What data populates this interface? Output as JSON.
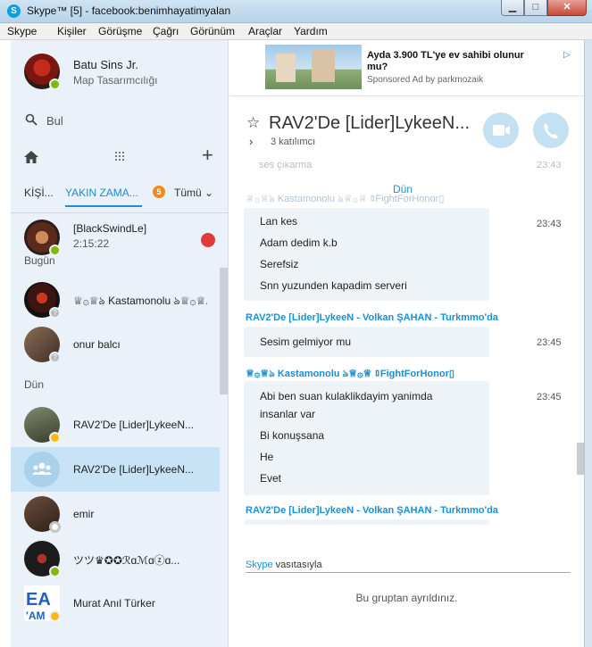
{
  "window": {
    "title": "Skype™ [5] - facebook:benimhayatimyalan",
    "app_icon": "S"
  },
  "menu": [
    "Skype",
    "Kişiler",
    "Görüşme",
    "Çağrı",
    "Görünüm",
    "Araçlar",
    "Yardım"
  ],
  "profile": {
    "name": "Batu Sins Jr.",
    "mood": "Map Tasarımcılığı",
    "status": "online"
  },
  "search": {
    "placeholder": "Bul"
  },
  "filters": {
    "contacts": "KİŞİ...",
    "recent": "YAKIN ZAMA...",
    "recent_count": "5",
    "all": "Tümü"
  },
  "contacts": [
    {
      "name": "[BlackSwindLe]",
      "sub": "2:15:22",
      "status": "online",
      "active_call": true
    },
    {
      "group_header": "Bugün"
    },
    {
      "name": "♕۞♕ঌ Kastamonolu ঌ♕۞♕...",
      "status": "unknown"
    },
    {
      "name": "onur balcı",
      "status": "unknown"
    },
    {
      "group_header": "Dün"
    },
    {
      "name": "RAV2'De [Lider]LykeeN...",
      "status": "away"
    },
    {
      "name": "RAV2'De [Lider]LykeeN...",
      "status": "group",
      "selected": true
    },
    {
      "name": "emir",
      "status": "offline"
    },
    {
      "name": "ツツ♛✪✪ℛɑℳɑⓩɑ...",
      "status": "online"
    },
    {
      "name": "Murat Anıl Türker",
      "status": "away"
    }
  ],
  "ad": {
    "title": "Ayda 3.900 TL'ye ev sahibi olunur mu?",
    "sponsor": "Sponsored Ad by parkmozaik",
    "adchoice": "▷"
  },
  "conversation": {
    "title": "RAV2'De [Lider]LykeeN...",
    "participants": "3 katılımcı",
    "messages_clipped_text": "ses çıkarma",
    "clipped_time": "23:43",
    "faded_sender": "♕۞♕ঌ Kastamonolu ঌ♕۞♕ ▯FightForHonor▯",
    "date_separator": "Dün",
    "groups": [
      {
        "lines": [
          "Lan kes",
          "Adam dedim k.b",
          "Serefsiz",
          "Snn yuzunden kapadim serveri"
        ],
        "time": "23:43"
      },
      {
        "sender": "RAV2'De [Lider]LykeeN - Volkan ŞAHAN - Turkmmo'da",
        "lines": [
          "Sesim gelmiyor mu"
        ],
        "time": "23:45"
      },
      {
        "sender": "♕۞♕ঌ Kastamonolu ঌ♕۞♕ ▯FightForHonor▯",
        "lines": [
          "Abi ben suan kulaklikdayim yanimda",
          "insanlar var",
          "Bi konuşsana",
          "He",
          "Evet"
        ],
        "time": "23:45"
      },
      {
        "sender": "RAV2'De [Lider]LykeeN - Volkan ŞAHAN - Turkmmo'da",
        "lines": []
      }
    ],
    "via_brand": "Skype",
    "via_text": " vasıtasıyla",
    "left_note": "Bu gruptan ayrıldınız."
  },
  "colors": {
    "accent": "#1a8fd4",
    "online": "#7fba00",
    "away": "#fdb913",
    "end_call": "#e03a3a",
    "badge": "#f2891e"
  }
}
